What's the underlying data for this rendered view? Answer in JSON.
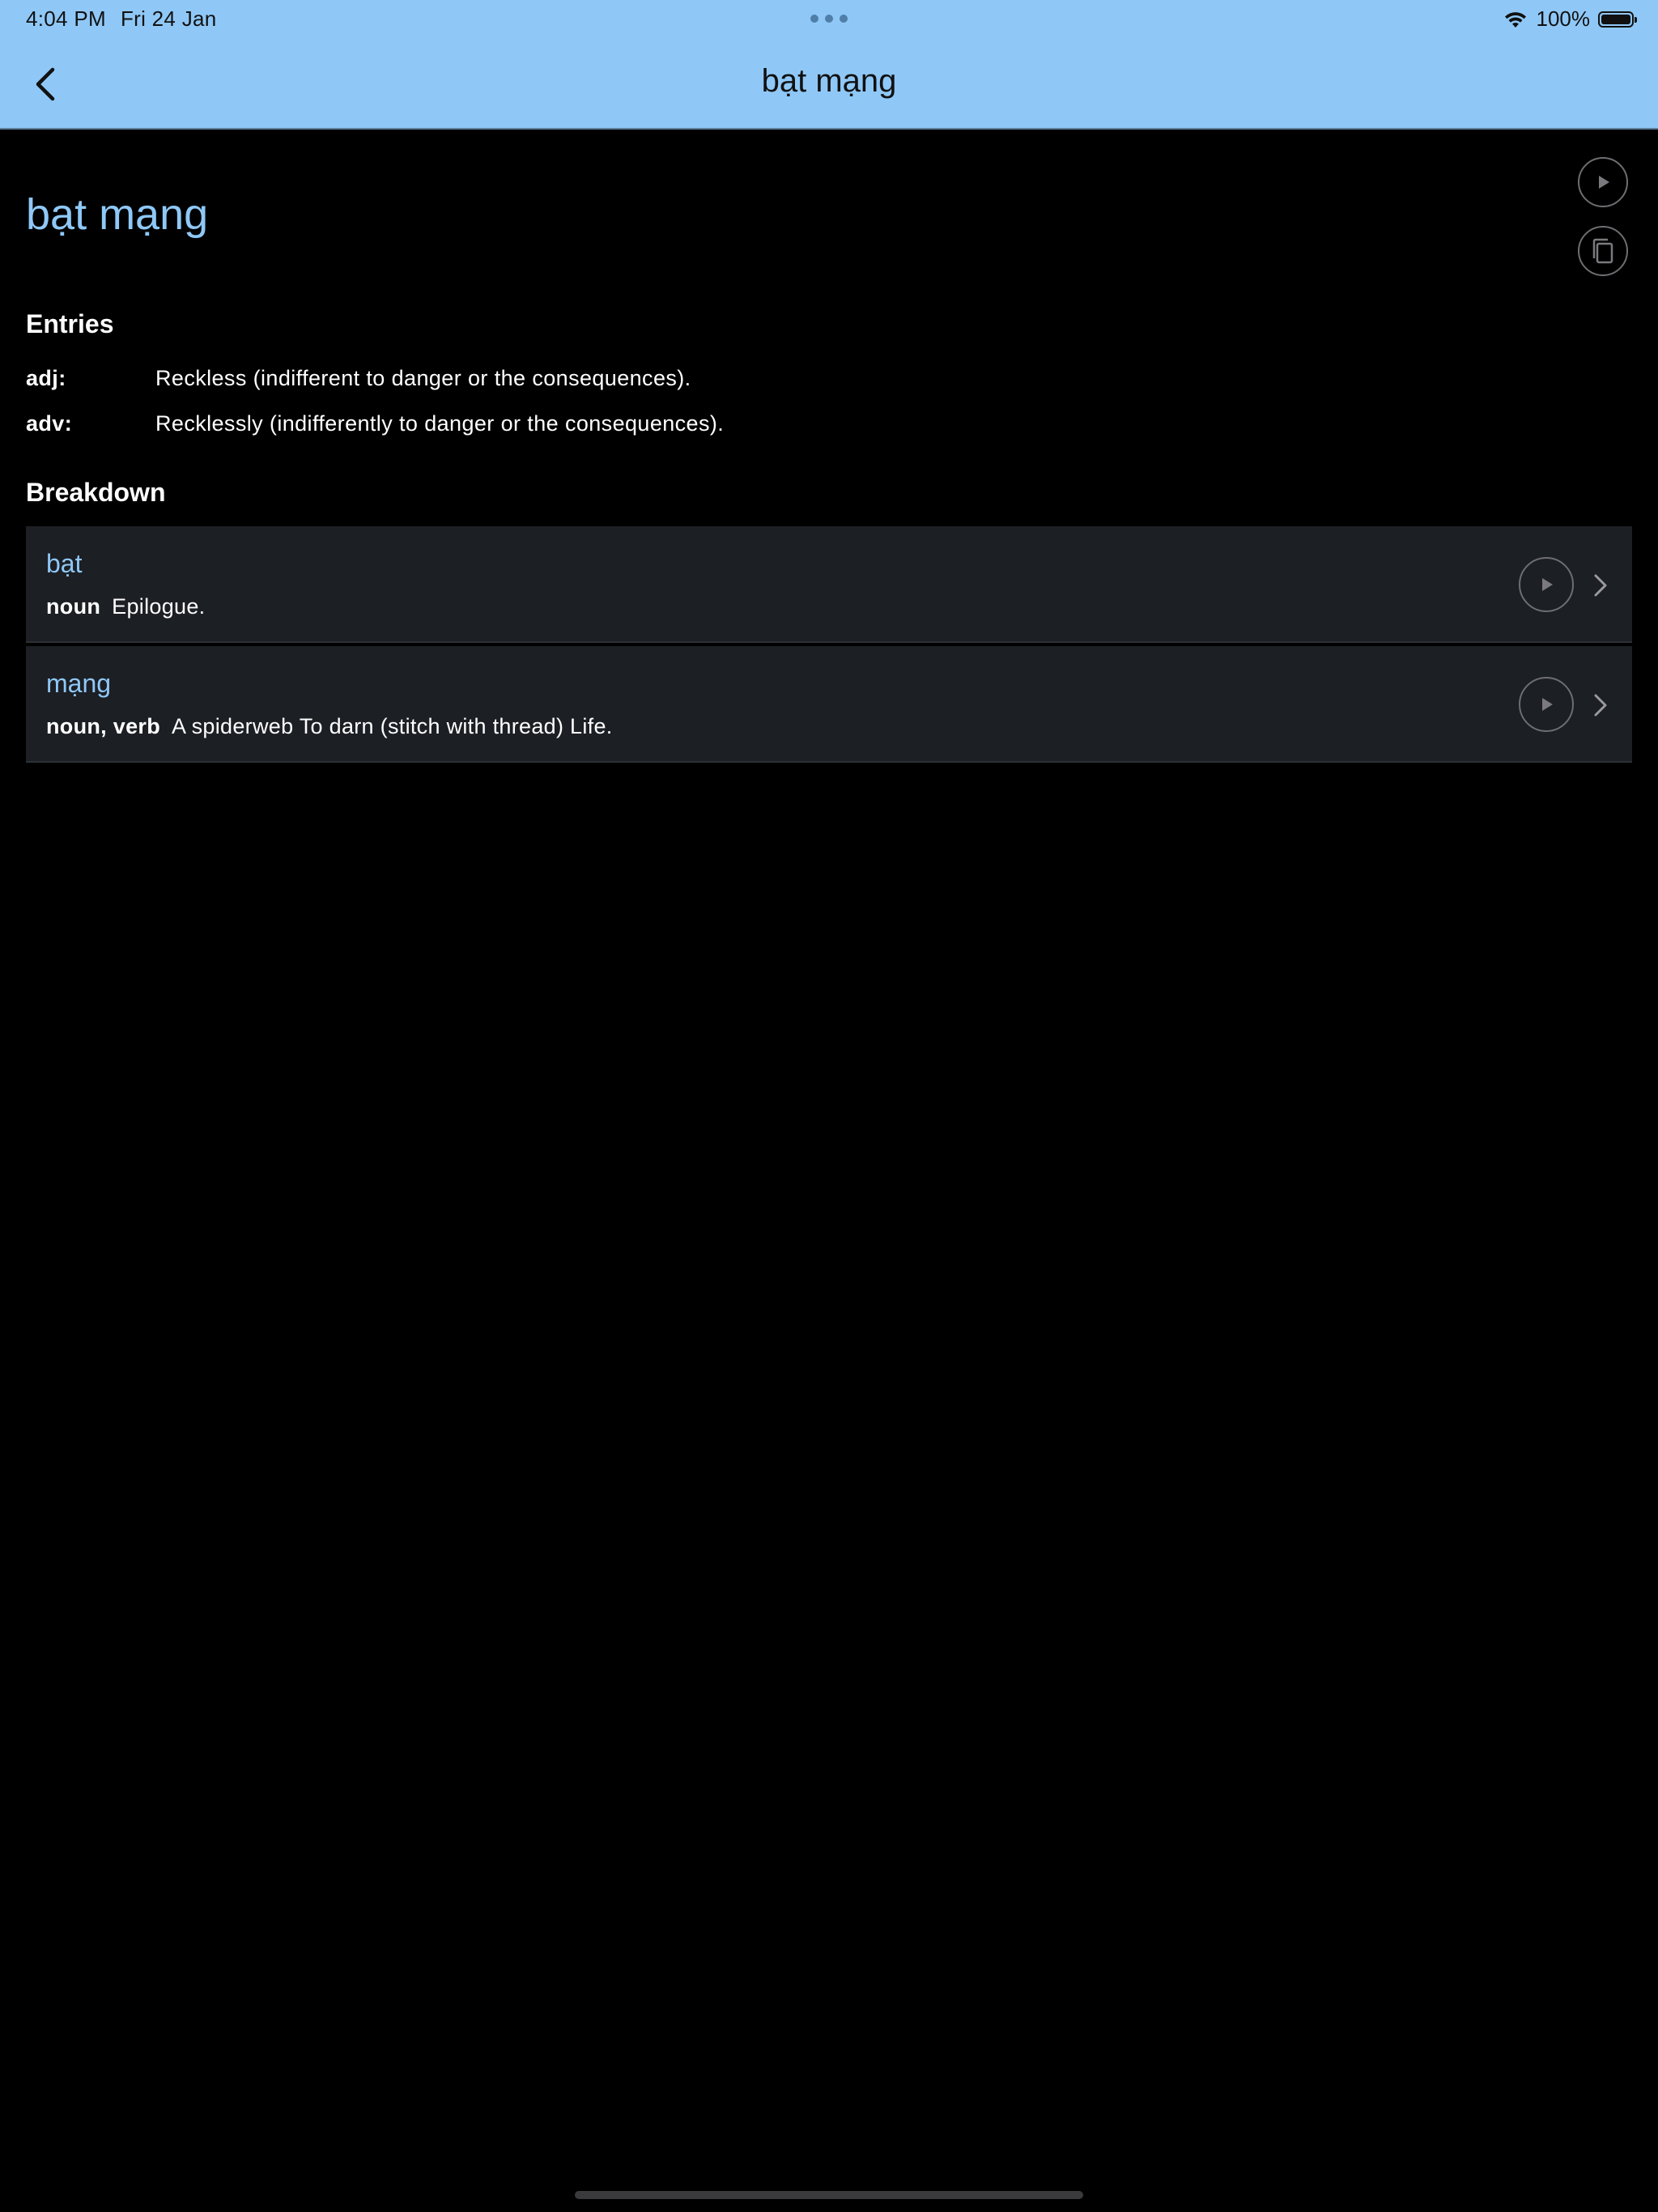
{
  "status_bar": {
    "time": "4:04 PM",
    "date": "Fri 24 Jan",
    "battery": "100%"
  },
  "nav": {
    "title": "bạt mạng",
    "back_icon": "chevron-left-icon"
  },
  "word": {
    "title": "bạt mạng",
    "play_icon": "play-icon",
    "copy_icon": "copy-icon"
  },
  "entries": {
    "heading": "Entries",
    "items": [
      {
        "pos": "adj:",
        "definition": "Reckless (indifferent to danger or the consequences)."
      },
      {
        "pos": "adv:",
        "definition": "Recklessly (indifferently to danger or the consequences)."
      }
    ]
  },
  "breakdown": {
    "heading": "Breakdown",
    "items": [
      {
        "word": "bạt",
        "pos": "noun",
        "definition": "Epilogue."
      },
      {
        "word": "mạng",
        "pos": "noun, verb",
        "definition": "A spiderweb To darn (stitch with thread) Life."
      }
    ]
  },
  "colors": {
    "accent": "#8fc8f7",
    "background": "#000000",
    "card": "#1c1f24"
  }
}
